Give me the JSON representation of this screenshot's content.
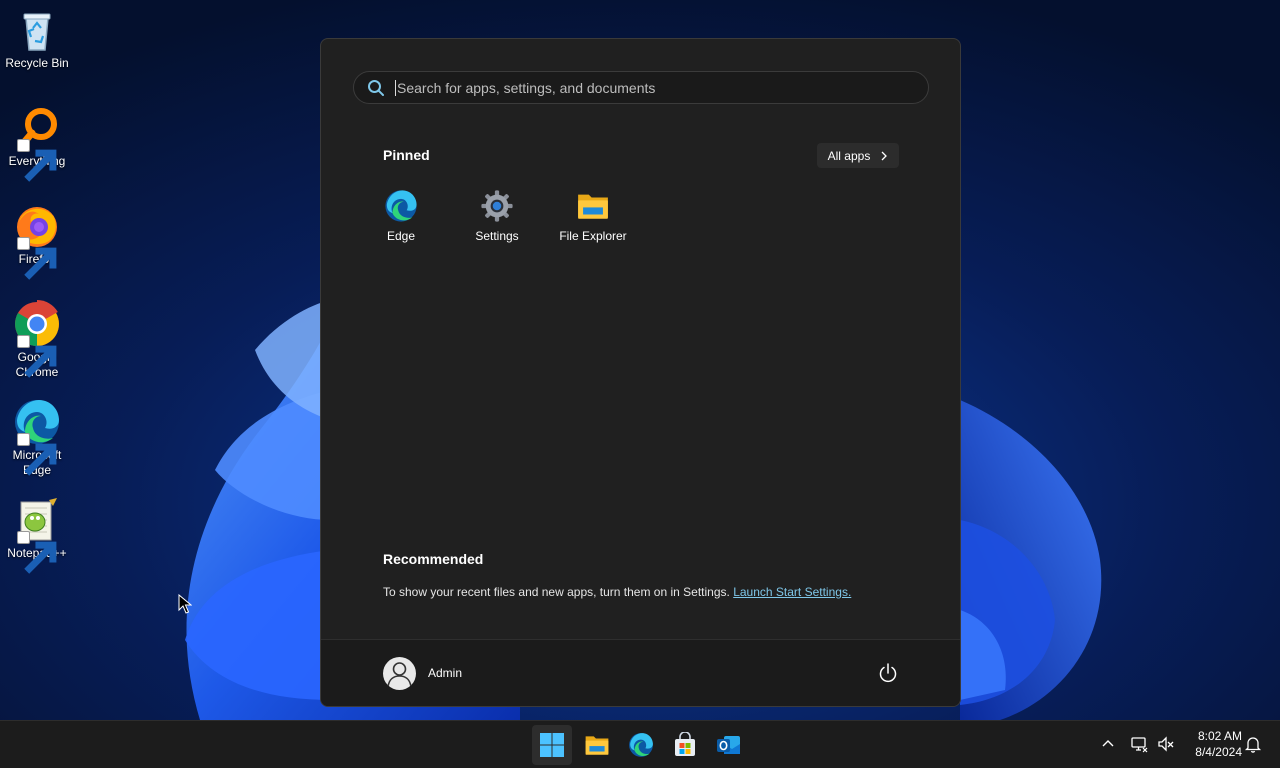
{
  "desktop": {
    "icons": [
      {
        "label": "Recycle Bin",
        "icon": "recycle-bin-icon"
      },
      {
        "label": "Everything",
        "icon": "everything-search-icon"
      },
      {
        "label": "Firefox",
        "icon": "firefox-icon"
      },
      {
        "label": "Google Chrome",
        "icon": "chrome-icon"
      },
      {
        "label": "Microsoft Edge",
        "icon": "edge-icon"
      },
      {
        "label": "Notepad++",
        "icon": "notepad-plus-plus-icon"
      }
    ]
  },
  "start_menu": {
    "search_placeholder": "Search for apps, settings, and documents",
    "pinned_title": "Pinned",
    "all_apps_label": "All apps",
    "pinned_apps": [
      {
        "label": "Edge",
        "icon": "edge-icon"
      },
      {
        "label": "Settings",
        "icon": "settings-gear-icon"
      },
      {
        "label": "File Explorer",
        "icon": "file-explorer-icon"
      }
    ],
    "recommended_title": "Recommended",
    "recommended_text": "To show your recent files and new apps, turn them on in Settings. ",
    "recommended_link": "Launch Start Settings.",
    "user_name": "Admin"
  },
  "taskbar": {
    "apps": [
      "start-icon",
      "file-explorer-icon",
      "edge-icon",
      "microsoft-store-icon",
      "outlook-icon"
    ],
    "clock_time": "8:02 AM",
    "clock_date": "8/4/2024"
  },
  "colors": {
    "start_bg": "#202020",
    "footer_bg": "#1b1b1b",
    "taskbar_bg": "#1c1c1c",
    "link": "#7fc7e9",
    "accent": "#4cc2ff"
  }
}
